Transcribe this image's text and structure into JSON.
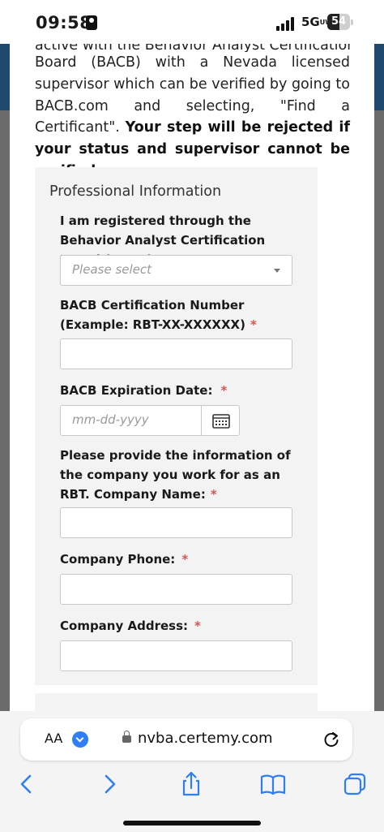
{
  "status_bar": {
    "time": "09:58",
    "network": "5G",
    "network_suffix": "UW",
    "battery": "54"
  },
  "intro": {
    "cut_line": "active with the Behavior Analyst Certification",
    "text": "Board (BACB) with a Nevada licensed supervisor which can be verified by going to BACB.com and selecting, \"Find a Certificant\".",
    "warning": "Your step will be rejected if your status and supervisor cannot be verified."
  },
  "card": {
    "title": "Professional Information",
    "bacb_registered": {
      "label": "I am registered through the Behavior Analyst Certification Board (BACB).",
      "required_mark": "*",
      "placeholder": "Please select"
    },
    "cert_number": {
      "label": "BACB Certification Number (Example: RBT-XX-XXXXXX)",
      "required_mark": "*",
      "value": ""
    },
    "expiration": {
      "label": "BACB Expiration Date:",
      "required_mark": "*",
      "placeholder": "mm-dd-yyyy"
    },
    "company_name": {
      "label": "Please provide the information of the company you work for as an RBT. Company Name:",
      "required_mark": "*",
      "value": ""
    },
    "company_phone": {
      "label": "Company Phone:",
      "required_mark": "*",
      "value": ""
    },
    "company_address": {
      "label": "Company Address:",
      "required_mark": "*",
      "value": ""
    }
  },
  "browser": {
    "text_size_label": "AA",
    "url": "nvba.certemy.com",
    "icons": [
      "extension-icon",
      "lock-icon",
      "reload-icon",
      "back-icon",
      "forward-icon",
      "share-icon",
      "bookmarks-icon",
      "tabs-icon"
    ]
  },
  "colors": {
    "accent_header": "#1f4a6e",
    "required": "#d9534f",
    "card_bg": "#f3f3f3",
    "link_blue": "#2f7ef5"
  }
}
